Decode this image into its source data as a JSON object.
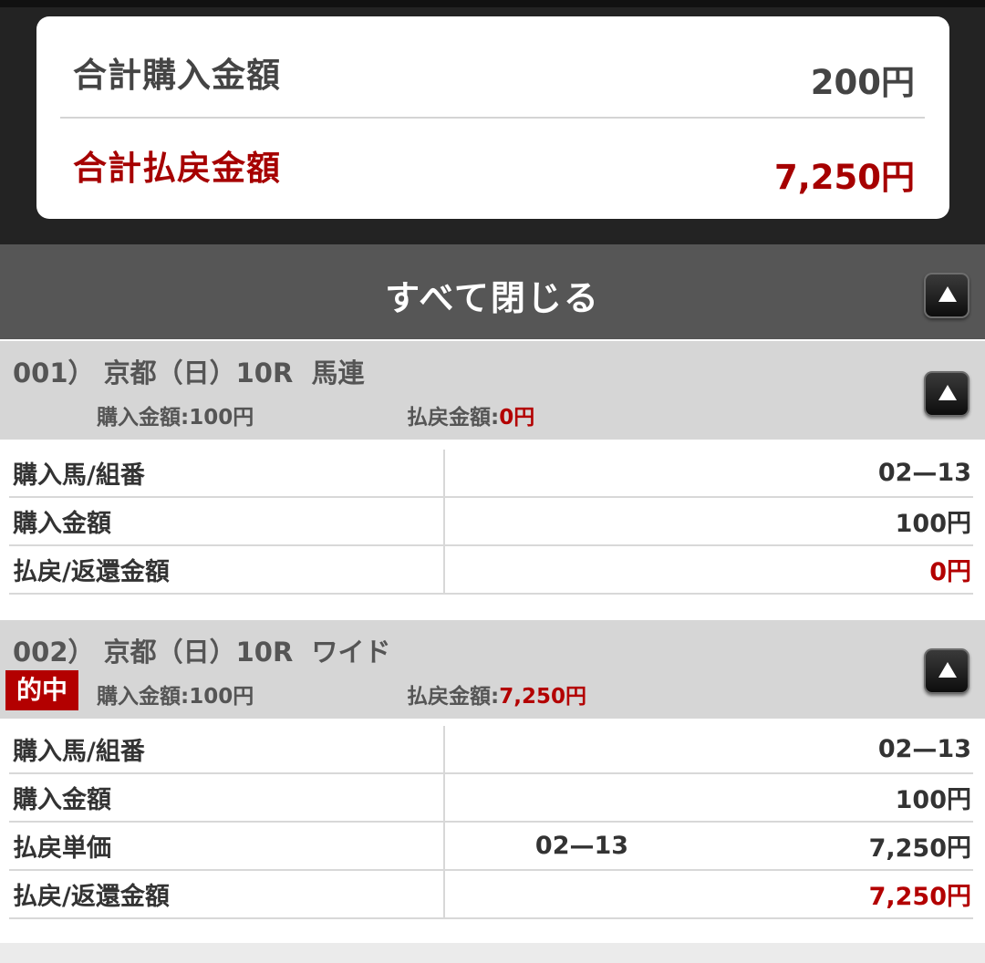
{
  "summary": {
    "total_purchase_label": "合計購入金額",
    "total_purchase_value": "200円",
    "total_payout_label": "合計払戻金額",
    "total_payout_value": "7,250円"
  },
  "close_all_label": "すべて閉じる",
  "bets": [
    {
      "title": "001） 京都（日）10R  馬連",
      "hit_badge": "",
      "purchase_label": "購入金額:",
      "purchase_value": "100円",
      "payout_label": "払戻金額:",
      "payout_value": "0円",
      "rows": [
        {
          "label": "購入馬/組番",
          "mid": "",
          "value": "02—13"
        },
        {
          "label": "購入金額",
          "mid": "",
          "value": "100円"
        },
        {
          "label": "払戻/返還金額",
          "mid": "",
          "value": "0円"
        }
      ]
    },
    {
      "title": "002） 京都（日）10R  ワイド",
      "hit_badge": "的中",
      "purchase_label": "購入金額:",
      "purchase_value": "100円",
      "payout_label": "払戻金額:",
      "payout_value": "7,250円",
      "rows": [
        {
          "label": "購入馬/組番",
          "mid": "",
          "value": "02—13"
        },
        {
          "label": "購入金額",
          "mid": "",
          "value": "100円"
        },
        {
          "label": "払戻単価",
          "mid": "02—13",
          "value": "7,250円"
        },
        {
          "label": "払戻/返還金額",
          "mid": "",
          "value": "7,250円"
        }
      ]
    }
  ],
  "icons": {
    "collapse": "collapse-arrow-up-icon"
  },
  "colors": {
    "accent_red": "#b30000",
    "header_dark": "#232323",
    "close_bar": "#565656",
    "section_header": "#d6d6d6"
  }
}
